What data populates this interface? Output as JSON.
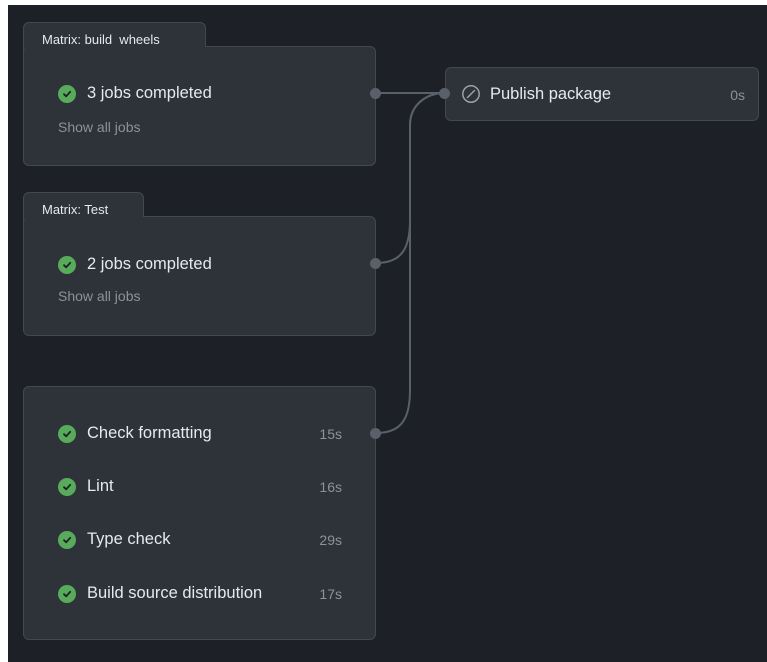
{
  "groups": [
    {
      "tab_label": "Matrix: build_wheels",
      "status": "3 jobs completed",
      "link": "Show all jobs"
    },
    {
      "tab_label": "Matrix: Test",
      "status": "2 jobs completed",
      "link": "Show all jobs"
    }
  ],
  "jobs": [
    {
      "name": "Check formatting",
      "duration": "15s"
    },
    {
      "name": "Lint",
      "duration": "16s"
    },
    {
      "name": "Type check",
      "duration": "29s"
    },
    {
      "name": "Build source distribution",
      "duration": "17s"
    }
  ],
  "publish": {
    "name": "Publish package",
    "duration": "0s",
    "icon": "skipped-icon"
  },
  "colors": {
    "background": "#1d2026",
    "card": "#2e3239",
    "border": "#43474f",
    "success": "#57ab5a",
    "connector": "#5a6069"
  }
}
